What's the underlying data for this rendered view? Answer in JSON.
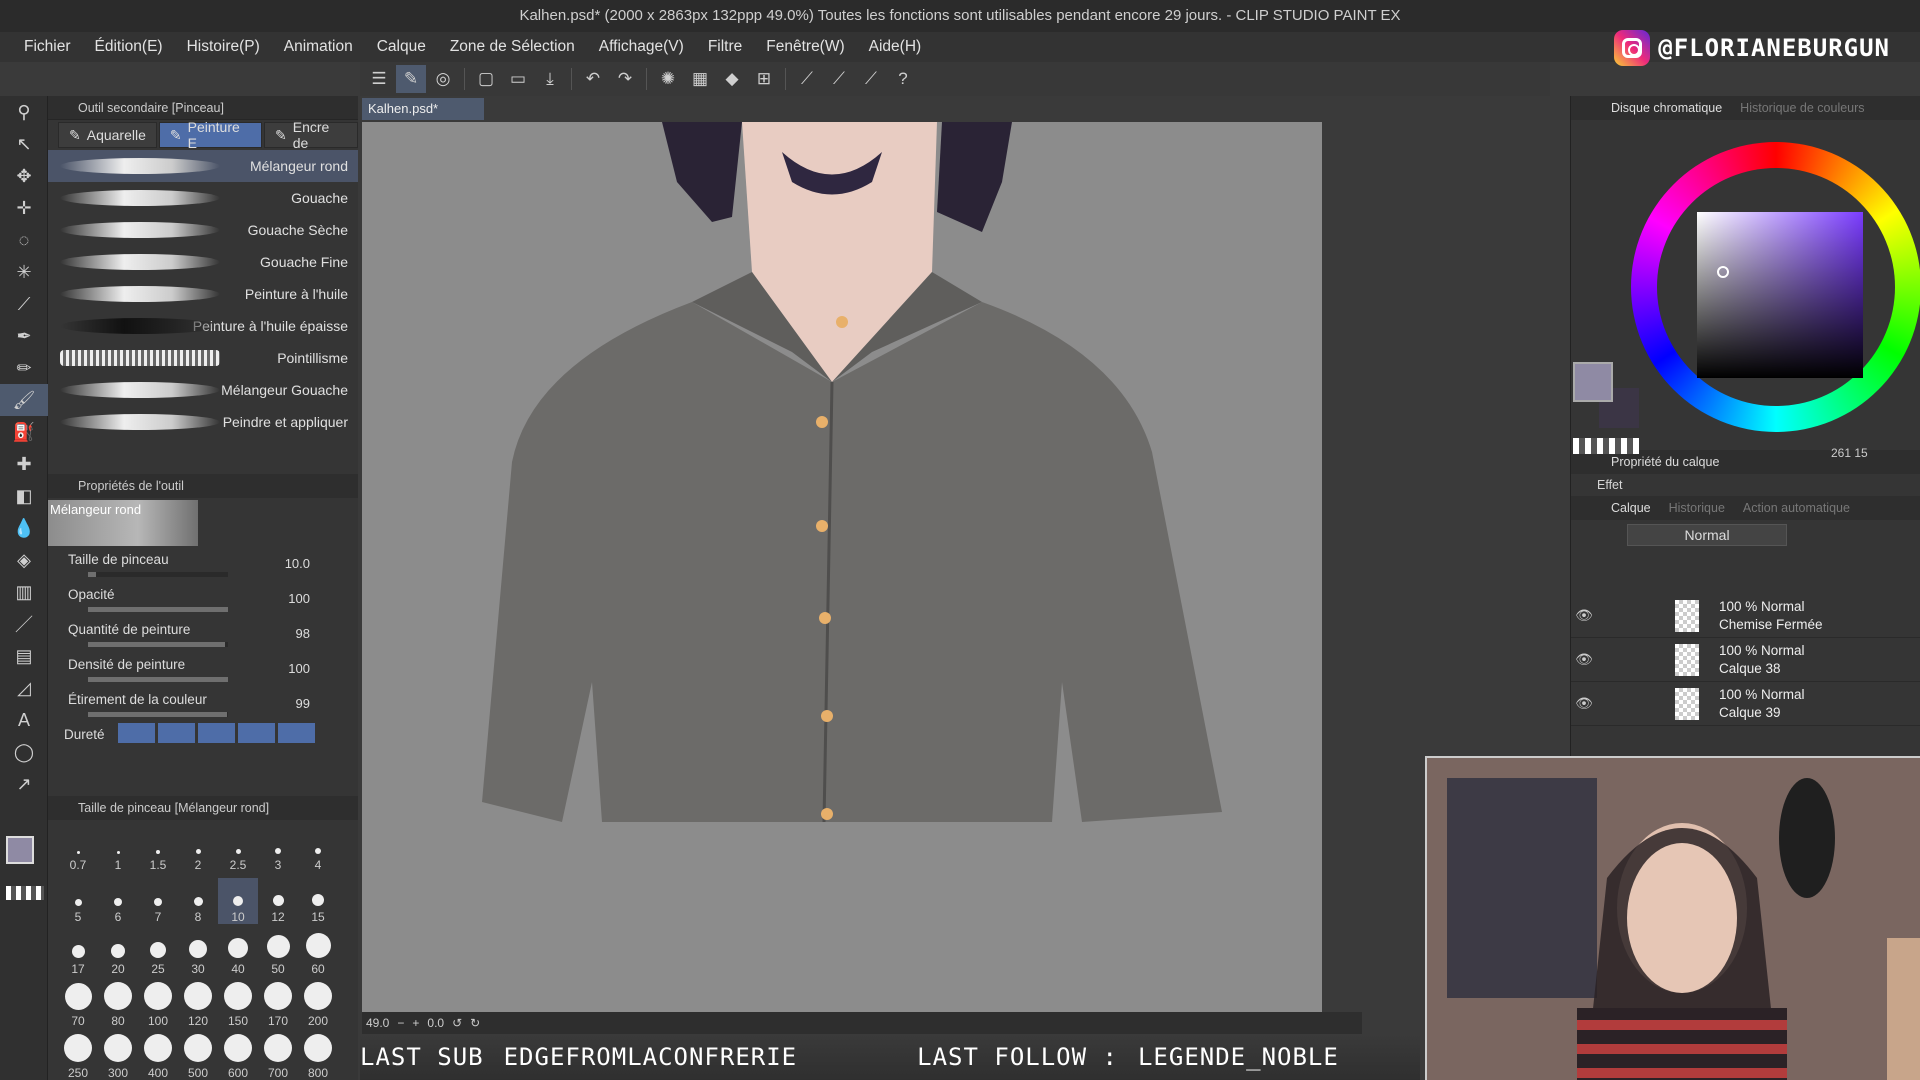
{
  "title": "Kalhen.psd* (2000 x 2863px 132ppp 49.0%)  Toutes les fonctions sont utilisables pendant encore 29 jours. - CLIP STUDIO PAINT EX",
  "menu": [
    "Fichier",
    "Édition(E)",
    "Histoire(P)",
    "Animation",
    "Calque",
    "Zone de Sélection",
    "Affichage(V)",
    "Filtre",
    "Fenêtre(W)",
    "Aide(H)"
  ],
  "instagram_handle": "@FLORIANEBURGUN",
  "subtool_panel": {
    "header": "Outil secondaire [Pinceau]",
    "tabs": [
      "Aquarelle",
      "Peinture E",
      "Encre de"
    ],
    "active_tab": 1,
    "brushes": [
      "Mélangeur rond",
      "Gouache",
      "Gouache Sèche",
      "Gouache Fine",
      "Peinture à l'huile",
      "Peinture à l'huile épaisse",
      "Pointillisme",
      "Mélangeur Gouache",
      "Peindre et appliquer"
    ],
    "active_brush": 0
  },
  "tool_props": {
    "header": "Propriétés de l'outil",
    "preview_label": "Mélangeur rond",
    "rows": [
      {
        "label": "Taille de pinceau",
        "value": "10.0",
        "level": 0.06
      },
      {
        "label": "Opacité",
        "value": "100",
        "level": 1.0
      },
      {
        "label": "Quantité de peinture",
        "value": "98",
        "level": 0.98
      },
      {
        "label": "Densité de peinture",
        "value": "100",
        "level": 1.0
      },
      {
        "label": "Étirement de la couleur",
        "value": "99",
        "level": 0.99
      }
    ],
    "hardness_label": "Dureté"
  },
  "brush_size": {
    "header": "Taille de pinceau [Mélangeur rond]",
    "sizes": [
      "0.7",
      "1",
      "1.5",
      "2",
      "2.5",
      "3",
      "4",
      "5",
      "6",
      "7",
      "8",
      "10",
      "12",
      "15",
      "17",
      "20",
      "25",
      "30",
      "40",
      "50",
      "60",
      "70",
      "80",
      "100",
      "120",
      "150",
      "170",
      "200",
      "250",
      "300",
      "400",
      "500",
      "600",
      "700",
      "800"
    ],
    "active": "10"
  },
  "document": {
    "tab": "Kalhen.psd*",
    "zoom": "49.0",
    "angle": "0.0"
  },
  "color_panel": {
    "tab_active": "Disque chromatique",
    "tab_other": "Historique de couleurs",
    "main_color": "#8f8aa4",
    "sub_color": "#3b3545",
    "readout": "261  15"
  },
  "layer_prop": {
    "header": "Propriété du calque",
    "effect": "Effet"
  },
  "layers": {
    "tabs": [
      "Calque",
      "Historique",
      "Action automatique"
    ],
    "blend": "Normal",
    "items": [
      {
        "pct": "100 % Normal",
        "name": "Chemise Fermée"
      },
      {
        "pct": "100 % Normal",
        "name": "Calque 38"
      },
      {
        "pct": "100 % Normal",
        "name": "Calque 39"
      }
    ]
  },
  "overlay": {
    "last_sub": "LAST SUB",
    "sub_name": "EDGEFROMLACONFRERIE",
    "last_follow": "LAST FOLLOW :",
    "follow_name": "LEGENDE_NOBLE"
  }
}
